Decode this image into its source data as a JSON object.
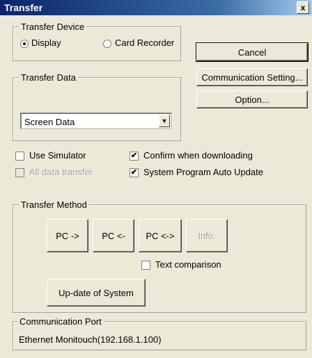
{
  "window": {
    "title": "Transfer",
    "close_glyph": "x"
  },
  "transfer_device": {
    "title": "Transfer Device",
    "options": [
      {
        "label": "Display",
        "selected": true
      },
      {
        "label": "Card Recorder",
        "selected": false
      }
    ]
  },
  "buttons": {
    "cancel": "Cancel",
    "communication_setting": "Communication Setting...",
    "option": "Option..."
  },
  "transfer_data": {
    "title": "Transfer Data",
    "selected": "Screen Data",
    "arrow_glyph": "▼"
  },
  "checkboxes": {
    "use_simulator": {
      "label": "Use Simulator",
      "checked": false,
      "enabled": true
    },
    "all_data_transfer": {
      "label": "All data transfer",
      "checked": false,
      "enabled": false
    },
    "confirm_downloading": {
      "label": "Confirm when downloading",
      "checked": true,
      "enabled": true
    },
    "system_program_auto_update": {
      "label": "System Program Auto Update",
      "checked": true,
      "enabled": true
    },
    "text_comparison": {
      "label": "Text comparison",
      "checked": false,
      "enabled": true
    }
  },
  "transfer_method": {
    "title": "Transfer Method",
    "pc_to": "PC ->",
    "pc_from": "PC <-",
    "pc_both": "PC <->",
    "info": "Info.",
    "update_system": "Up-date of System"
  },
  "communication_port": {
    "title": "Communication Port",
    "value": "Ethernet Monitouch(192.168.1.100)"
  },
  "check_glyph": "✔"
}
